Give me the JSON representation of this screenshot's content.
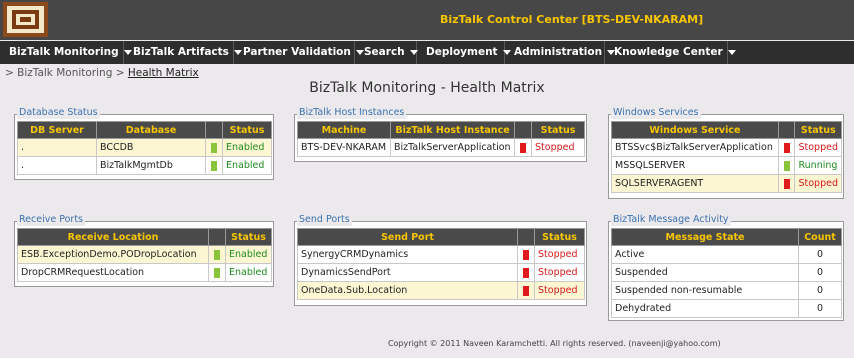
{
  "header": {
    "title": "BizTalk Control Center [BTS-DEV-NKARAM]"
  },
  "nav": [
    {
      "label": "BizTalk Monitoring"
    },
    {
      "label": "BizTalk Artifacts"
    },
    {
      "label": "Partner Validation"
    },
    {
      "label": "Search"
    },
    {
      "label": "Deployment"
    },
    {
      "label": "Administration"
    },
    {
      "label": "Knowledge Center"
    }
  ],
  "breadcrumb": {
    "prefix": "> BizTalk Monitoring > ",
    "current": "Health Matrix"
  },
  "page_title": "BizTalk Monitoring - Health Matrix",
  "colors": {
    "enabled": "#89c43a",
    "stopped": "#e01a1a",
    "header_text": "#f7c600"
  },
  "panels": {
    "db": {
      "legend": "Database Status",
      "headers": [
        "DB Server",
        "Database",
        "",
        "Status"
      ],
      "rows": [
        {
          "server": ".",
          "database": "BCCDB",
          "status": "Enabled"
        },
        {
          "server": ".",
          "database": "BizTalkMgmtDb",
          "status": "Enabled"
        }
      ]
    },
    "host": {
      "legend": "BizTalk Host Instances",
      "headers": [
        "Machine",
        "BizTalk Host Instance",
        "",
        "Status"
      ],
      "rows": [
        {
          "machine": "BTS-DEV-NKARAM",
          "instance": "BizTalkServerApplication",
          "status": "Stopped"
        }
      ]
    },
    "win": {
      "legend": "Windows Services",
      "headers": [
        "Windows Service",
        "",
        "Status"
      ],
      "rows": [
        {
          "service": "BTSSvc$BizTalkServerApplication",
          "status": "Stopped"
        },
        {
          "service": "MSSQLSERVER",
          "status": "Running"
        },
        {
          "service": "SQLSERVERAGENT",
          "status": "Stopped"
        }
      ]
    },
    "recv": {
      "legend": "Receive Ports",
      "headers": [
        "Receive Location",
        "",
        "Status"
      ],
      "rows": [
        {
          "location": "ESB.ExceptionDemo.PODropLocation",
          "status": "Enabled"
        },
        {
          "location": "DropCRMRequestLocation",
          "status": "Enabled"
        }
      ]
    },
    "send": {
      "legend": "Send Ports",
      "headers": [
        "Send Port",
        "",
        "Status"
      ],
      "rows": [
        {
          "port": "SynergyCRMDynamics",
          "status": "Stopped"
        },
        {
          "port": "DynamicsSendPort",
          "status": "Stopped"
        },
        {
          "port": "OneData.Sub.Location",
          "status": "Stopped"
        }
      ]
    },
    "msg": {
      "legend": "BizTalk Message Activity",
      "headers": [
        "Message State",
        "Count"
      ],
      "rows": [
        {
          "state": "Active",
          "count": "0"
        },
        {
          "state": "Suspended",
          "count": "0"
        },
        {
          "state": "Suspended non-resumable",
          "count": "0"
        },
        {
          "state": "Dehydrated",
          "count": "0"
        }
      ]
    }
  },
  "footer": "Copyright © 2011 Naveen Karamchetti. All rights reserved. (naveenji@yahoo.com)"
}
